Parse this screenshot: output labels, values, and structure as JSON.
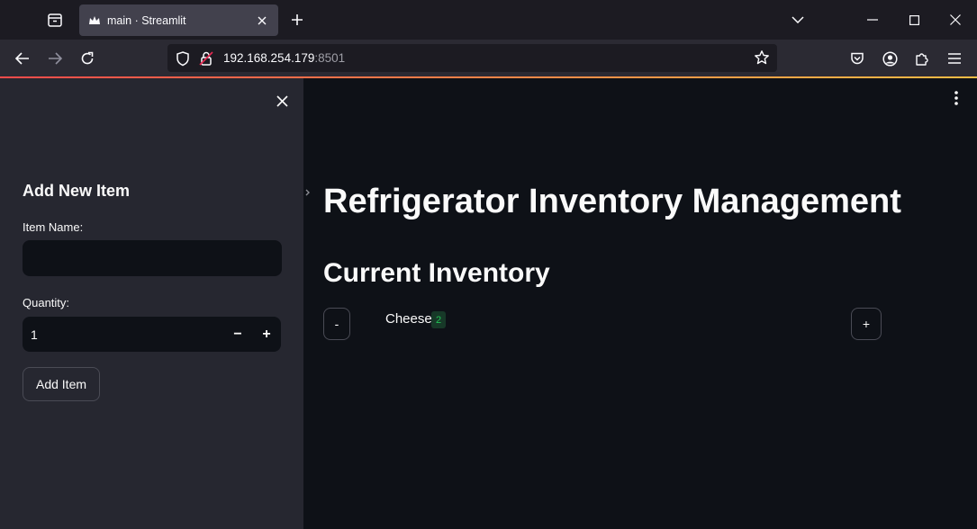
{
  "browser": {
    "tab_title": "main · Streamlit",
    "url_host": "192.168.254.179",
    "url_port": ":8501"
  },
  "sidebar": {
    "heading": "Add New Item",
    "item_name_label": "Item Name:",
    "item_name_value": "",
    "quantity_label": "Quantity:",
    "quantity_value": "1",
    "decrement_label": "−",
    "increment_label": "+",
    "add_button_label": "Add Item"
  },
  "main": {
    "title": "Refrigerator Inventory Management",
    "section_title": "Current Inventory",
    "items": [
      {
        "name": "Cheese",
        "quantity": "2",
        "minus_label": "-",
        "plus_label": "+"
      }
    ]
  },
  "colors": {
    "background": "#0e1117",
    "sidebar": "#262730",
    "text": "#fafafa",
    "badge_text": "#21c354",
    "accent": "#ff4b4b"
  }
}
